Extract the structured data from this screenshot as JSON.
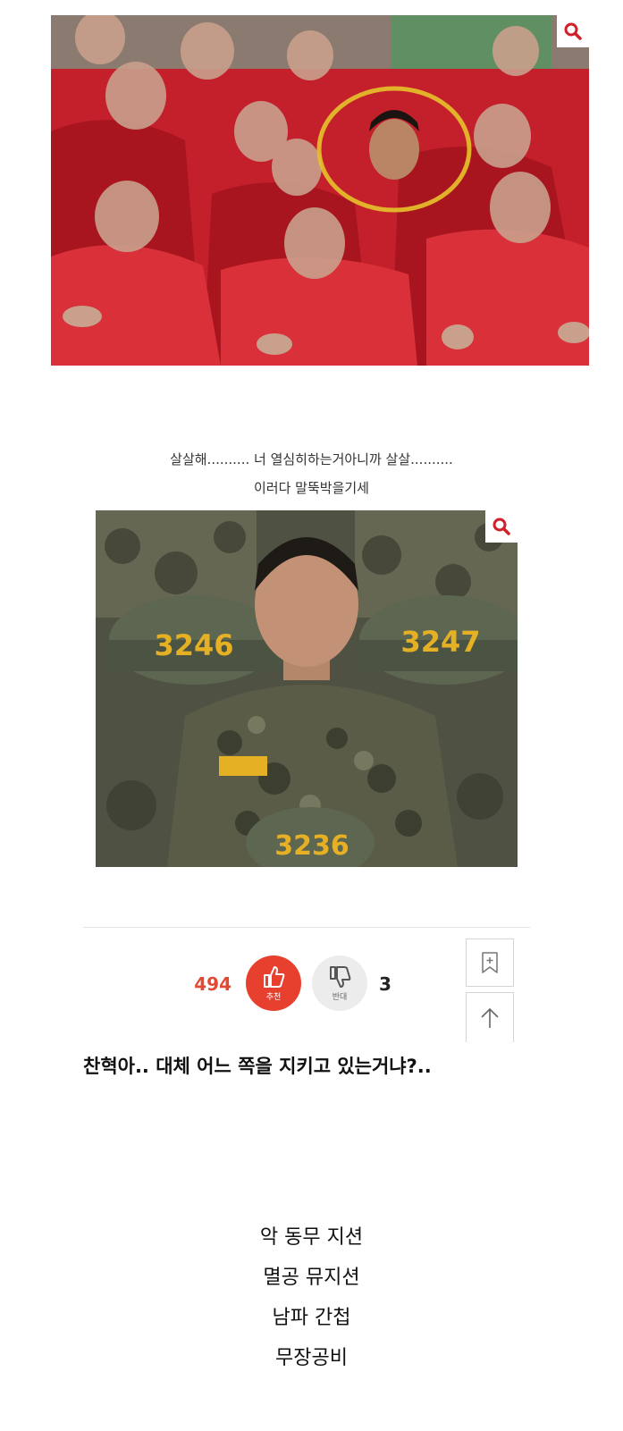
{
  "post": {
    "caption_lines": [
      "살살해.......... 너 열심히하는거아니까 살살..........",
      "이러다 말뚝박을기세"
    ],
    "images": [
      {
        "name": "red-uniform-group-photo",
        "zoom_icon": "search-icon"
      },
      {
        "name": "marine-camouflage-photo",
        "zoom_icon": "search-icon",
        "helmet_numbers": [
          "3246",
          "3247",
          "3236"
        ]
      }
    ]
  },
  "vote": {
    "up_count": "494",
    "up_label": "추천",
    "up_icon": "thumbs-up-icon",
    "down_label": "반대",
    "down_icon": "thumbs-down-icon",
    "down_count": "3"
  },
  "side_actions": {
    "bookmark_icon": "bookmark-add-icon",
    "top_icon": "arrow-up-icon"
  },
  "comment": "찬혁아.. 대체 어느 쪽을 지키고 있는거냐?..",
  "tags": [
    "악 동무 지션",
    "멸공 뮤지션",
    "남파 간첩",
    "무장공비"
  ],
  "colors": {
    "accent": "#e8402f",
    "up_count": "#e24a33",
    "divider": "#e1e1e1",
    "red_uniform": "#c4202c",
    "camo": "#5a5c48",
    "helmet_number": "#e6b025"
  }
}
